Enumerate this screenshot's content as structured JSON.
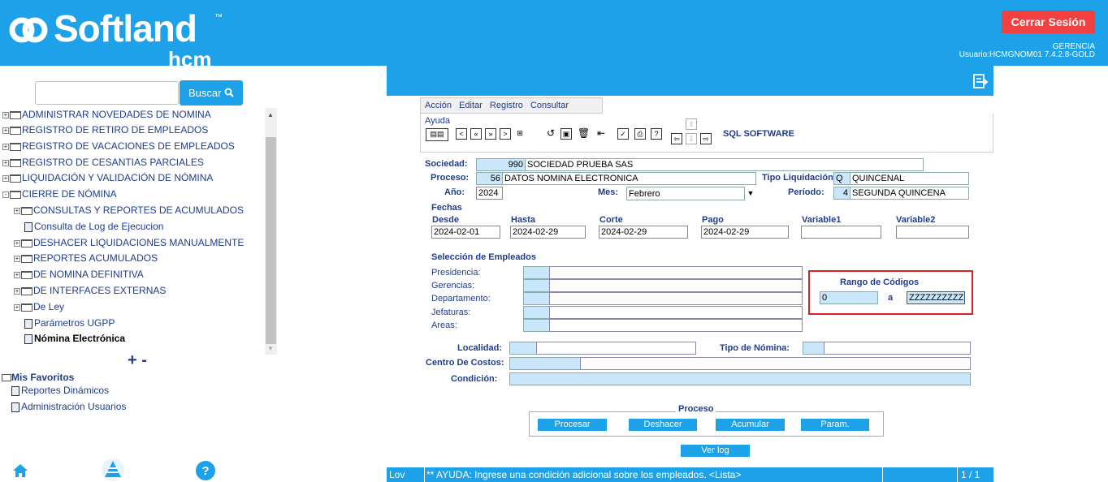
{
  "header": {
    "brand": "Softland",
    "brand_sub": "hcm",
    "trademark": "™",
    "logout_label": "Cerrar Sesión",
    "user_role": "GERENCIA",
    "user_info": "Usuario:HCMGNOM01 7.4.2.8-GOLD"
  },
  "sidebar": {
    "search_placeholder": "",
    "search_button": "Buscar",
    "tree": [
      {
        "label": "ADMINISTRAR NOVEDADES DE NOMINA"
      },
      {
        "label": "REGISTRO DE RETIRO DE EMPLEADOS"
      },
      {
        "label": "REGISTRO DE VACACIONES DE EMPLEADOS"
      },
      {
        "label": "REGISTRO DE CESANTIAS PARCIALES"
      },
      {
        "label": "LIQUIDACIÓN Y VALIDACIÓN DE NÓMINA"
      },
      {
        "label": "CIERRE DE NÓMINA"
      },
      {
        "label": "CONSULTAS Y REPORTES DE ACUMULADOS"
      },
      {
        "label": "Consulta de Log de Ejecucion"
      },
      {
        "label": "DESHACER LIQUIDACIONES MANUALMENTE"
      },
      {
        "label": "REPORTES ACUMULADOS"
      },
      {
        "label": "DE NOMINA DEFINITIVA"
      },
      {
        "label": "DE INTERFACES EXTERNAS"
      },
      {
        "label": "De Ley"
      },
      {
        "label": "Parámetros UGPP"
      },
      {
        "label": "Nómina Electrónica"
      }
    ],
    "expand_collapse": "+ -",
    "favorites_title": "Mis Favoritos",
    "favorites": [
      "Reportes Dinámicos",
      "Administración Usuarios"
    ],
    "bottom_icons": [
      "home-icon",
      "logo-icon",
      "help-icon"
    ]
  },
  "menu": [
    "Acción",
    "Editar",
    "Registro",
    "Consultar",
    "Ayuda"
  ],
  "toolbar": {
    "company_label": "SQL SOFTWARE"
  },
  "form": {
    "sociedad_label": "Sociedad:",
    "sociedad_code": "990",
    "sociedad_name": "SOCIEDAD  PRUEBA SAS",
    "proceso_label": "Proceso:",
    "proceso_code": "56",
    "proceso_name": "DATOS NOMINA ELECTRONICA",
    "tipo_liq_label": "Tipo Liquidación:",
    "tipo_liq_code": "Q",
    "tipo_liq_name": "QUINCENAL",
    "anio_label": "Año:",
    "anio_value": "2024",
    "mes_label": "Mes:",
    "mes_value": "Febrero",
    "periodo_label": "Período:",
    "periodo_code": "4",
    "periodo_name": "SEGUNDA QUINCENA",
    "fechas_label": "Fechas",
    "desde_label": "Desde",
    "desde_value": "2024-02-01",
    "hasta_label": "Hasta",
    "hasta_value": "2024-02-29",
    "corte_label": "Corte",
    "corte_value": "2024-02-29",
    "pago_label": "Pago",
    "pago_value": "2024-02-29",
    "variable1_label": "Variable1",
    "variable1_value": "",
    "variable2_label": "Variable2",
    "variable2_value": "",
    "seleccion_label": "Selección de Empleados",
    "presidencia_label": "Presidencia:",
    "gerencias_label": "Gerencias:",
    "departamento_label": "Departamento:",
    "jefaturas_label": "Jefaturas:",
    "areas_label": "Areas:",
    "rango_label": "Rango de Códigos",
    "rango_from": "0",
    "rango_a": "a",
    "rango_to": "ZZZZZZZZZZ",
    "localidad_label": "Localidad:",
    "tipo_nomina_label": "Tipo de Nómina:",
    "centro_costos_label": "Centro De Costos:",
    "condicion_label": "Condición:"
  },
  "actions": {
    "proceso_label": "Proceso",
    "procesar": "Procesar",
    "deshacer": "Deshacer",
    "acumular": "Acumular",
    "param": "Param.",
    "ver_log": "Ver log"
  },
  "status": {
    "mode": "Lov",
    "message": "** AYUDA: Ingrese una condición adicional sobre los empleados. <Lista>",
    "record": "1 / 1"
  },
  "colors": {
    "primary": "#1da1e8",
    "danger": "#f04040",
    "field": "#c9e6fa",
    "label": "#1f3c8f"
  }
}
